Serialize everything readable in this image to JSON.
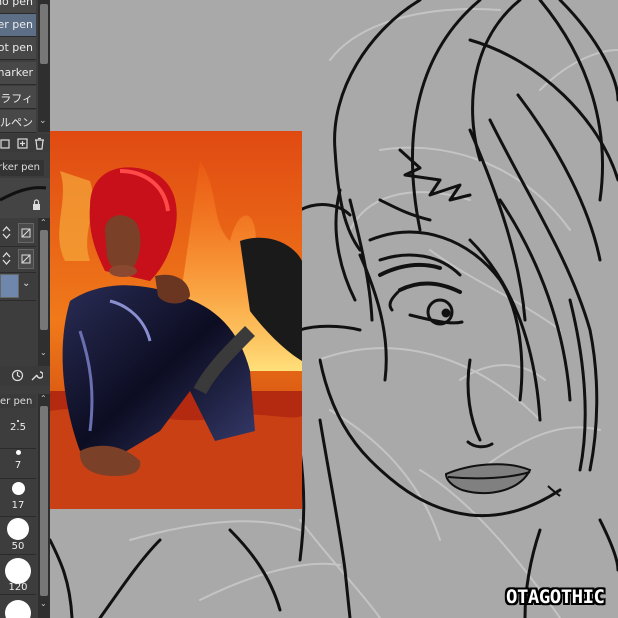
{
  "brush_list": {
    "items": [
      {
        "label": "no pen",
        "selected": false
      },
      {
        "label": "ker pen",
        "selected": true
      },
      {
        "label": "Dot pen",
        "selected": false
      },
      {
        "label": "marker",
        "selected": false
      },
      {
        "label": "グラフィ",
        "selected": false
      },
      {
        "label": "ルペン",
        "selected": false
      }
    ]
  },
  "tool_properties": {
    "subtool_name": "marker pen"
  },
  "brush_size": {
    "header": "er pen",
    "sizes": [
      "2.5",
      "7",
      "17",
      "50",
      "120"
    ]
  },
  "watermark": {
    "text": "OTAGOTHIC"
  },
  "colors": {
    "panel_bg": "#3d3d3d",
    "selected_item": "#5d6f86",
    "canvas_bg": "#a9a9a9",
    "line_art": "#111111",
    "sketch": "#c4c4c4",
    "lips": "#808080"
  },
  "icons": [
    "copy-subtool-icon",
    "new-subtool-icon",
    "delete-subtool-icon",
    "lock-icon",
    "spin-arrows-icon",
    "ruler-toggle-icon",
    "reset-icon",
    "wrench-icon",
    "scroll-up-icon",
    "scroll-down-icon"
  ]
}
